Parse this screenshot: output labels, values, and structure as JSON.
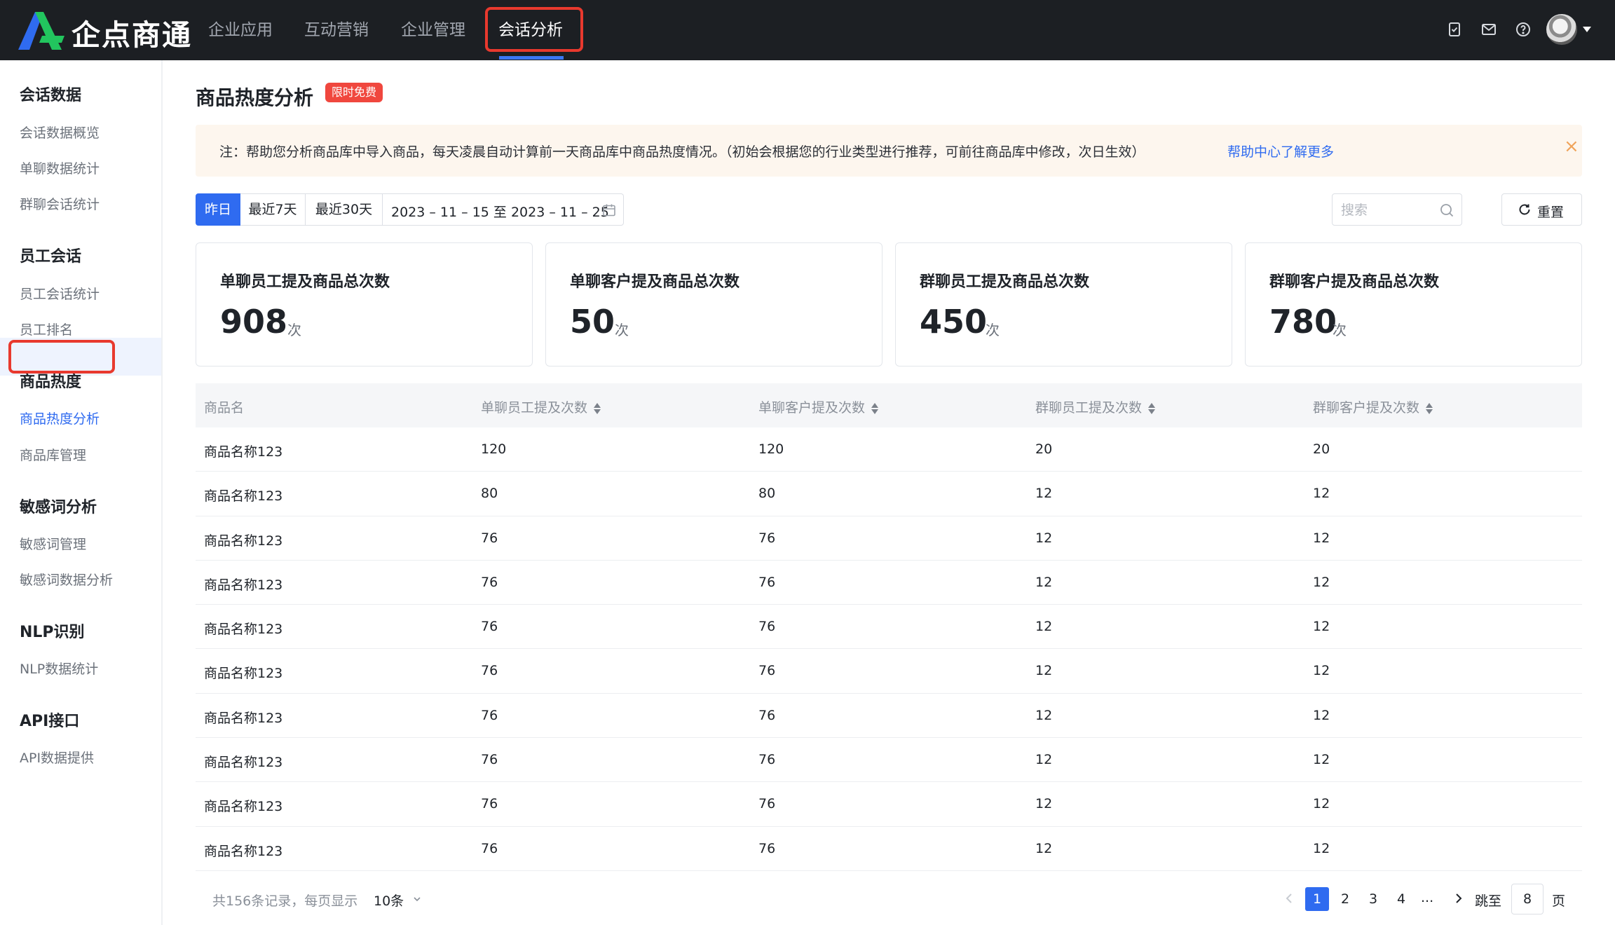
{
  "app": {
    "brand": "企点商通",
    "nav": [
      {
        "label": "企业应用"
      },
      {
        "label": "互动营销"
      },
      {
        "label": "企业管理"
      },
      {
        "label": "会话分析",
        "active": true
      }
    ],
    "icons": [
      "checklist-icon",
      "mail-icon",
      "help-icon",
      "avatar"
    ]
  },
  "sidebar": {
    "groups": [
      {
        "title": "会话数据",
        "items": [
          {
            "label": "会话数据概览"
          },
          {
            "label": "单聊数据统计"
          },
          {
            "label": "群聊会话统计"
          }
        ]
      },
      {
        "title": "员工会话",
        "items": [
          {
            "label": "员工会话统计"
          },
          {
            "label": "员工排名"
          }
        ]
      },
      {
        "title": "商品热度",
        "items": [
          {
            "label": "商品热度分析",
            "active": true
          },
          {
            "label": "商品库管理"
          }
        ]
      },
      {
        "title": "敏感词分析",
        "items": [
          {
            "label": "敏感词管理"
          },
          {
            "label": "敏感词数据分析"
          }
        ]
      },
      {
        "title": "NLP识别",
        "items": [
          {
            "label": "NLP数据统计"
          }
        ]
      },
      {
        "title": "API接口",
        "items": [
          {
            "label": "API数据提供"
          }
        ]
      }
    ]
  },
  "page": {
    "title": "商品热度分析",
    "badge": "限时免费",
    "notice": {
      "text": "注：帮助您分析商品库中导入商品，每天凌晨自动计算前一天商品库中商品热度情况。（初始会根据您的行业类型进行推荐，可前往商品库中修改，次日生效）",
      "link": "帮助中心了解更多",
      "close": "×"
    },
    "filters": {
      "ranges": [
        {
          "label": "昨日",
          "active": true
        },
        {
          "label": "最近7天"
        },
        {
          "label": "最近30天"
        }
      ],
      "date_range": "2023 – 11 – 15  至  2023 – 11 – 25",
      "search_placeholder": "搜索",
      "reset_label": "重置"
    },
    "stats": [
      {
        "title": "单聊员工提及商品总次数",
        "value": "908",
        "unit": "次"
      },
      {
        "title": "单聊客户提及商品总次数",
        "value": "50",
        "unit": "次"
      },
      {
        "title": "群聊员工提及商品总次数",
        "value": "450",
        "unit": "次"
      },
      {
        "title": "群聊客户提及商品总次数",
        "value": "780",
        "unit": "次"
      }
    ],
    "table": {
      "columns": [
        "商品名",
        "单聊员工提及次数",
        "单聊客户提及次数",
        "群聊员工提及次数",
        "群聊客户提及次数"
      ],
      "rows": [
        [
          "商品名称123",
          "120",
          "120",
          "20",
          "20"
        ],
        [
          "商品名称123",
          "80",
          "80",
          "12",
          "12"
        ],
        [
          "商品名称123",
          "76",
          "76",
          "12",
          "12"
        ],
        [
          "商品名称123",
          "76",
          "76",
          "12",
          "12"
        ],
        [
          "商品名称123",
          "76",
          "76",
          "12",
          "12"
        ],
        [
          "商品名称123",
          "76",
          "76",
          "12",
          "12"
        ],
        [
          "商品名称123",
          "76",
          "76",
          "12",
          "12"
        ],
        [
          "商品名称123",
          "76",
          "76",
          "12",
          "12"
        ],
        [
          "商品名称123",
          "76",
          "76",
          "12",
          "12"
        ],
        [
          "商品名称123",
          "76",
          "76",
          "12",
          "12"
        ]
      ]
    },
    "pagination": {
      "summary": "共156条记录，每页显示",
      "page_size": "10条",
      "pages": [
        "1",
        "2",
        "3",
        "4"
      ],
      "current": "1",
      "ellipsis": "...",
      "jump_label": "跳至",
      "jump_value": "8",
      "page_label": "页"
    }
  },
  "colors": {
    "topbar": "#1c1f23",
    "accent": "#2f6bf0",
    "highlight": "#e8392e",
    "badge": "#f0473e",
    "notice_bg": "#fdf6ee"
  }
}
